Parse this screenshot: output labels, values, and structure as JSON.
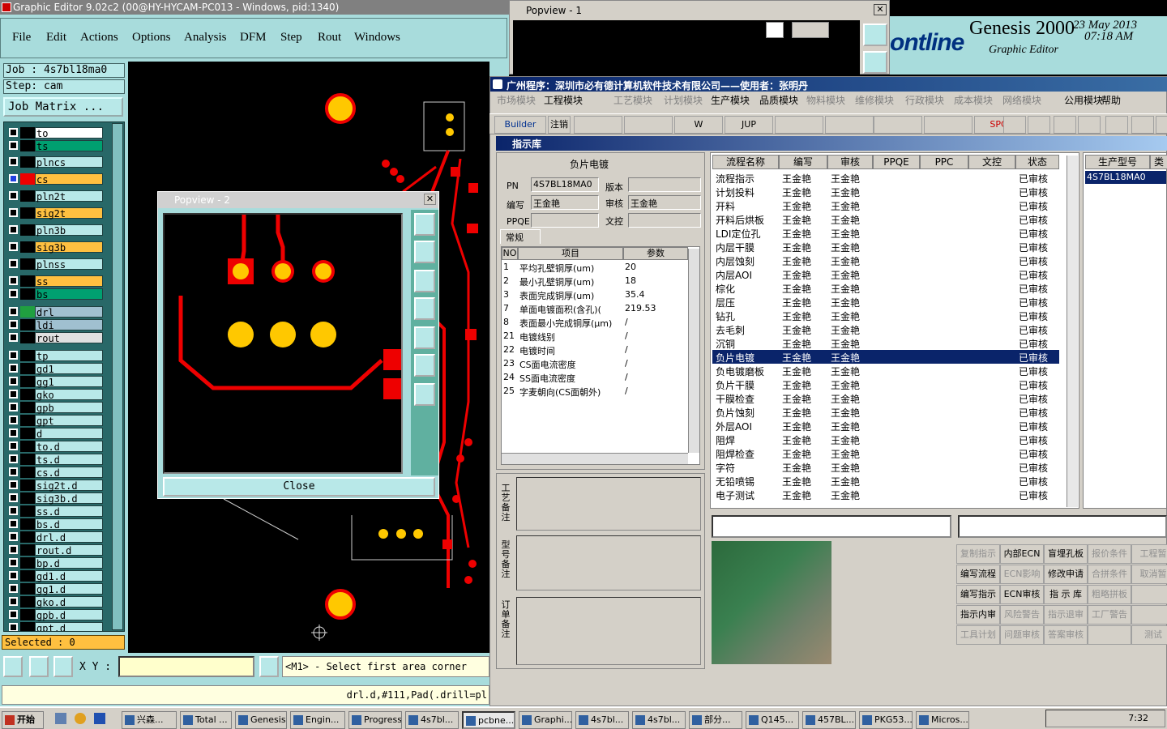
{
  "genesis": {
    "title": "Graphic Editor 9.02c2 (00@HY-HYCAM-PC013 - Windows, pid:1340)",
    "menu": [
      "File",
      "Edit",
      "Actions",
      "Options",
      "Analysis",
      "DFM",
      "Step",
      "Rout",
      "Windows"
    ],
    "job": "Job : 4s7bl18ma0",
    "step": "Step: cam",
    "job_matrix": "Job Matrix ...",
    "layers": [
      {
        "name": "to",
        "color": "#ffffff"
      },
      {
        "name": "ts",
        "color": "#00a070"
      },
      {
        "name": "plncs",
        "color": "#b8e8e8"
      },
      {
        "name": "cs",
        "color": "#ffc040"
      },
      {
        "name": "pln2t",
        "color": "#b8e8e8"
      },
      {
        "name": "sig2t",
        "color": "#ffc040"
      },
      {
        "name": "pln3b",
        "color": "#b8e8e8"
      },
      {
        "name": "sig3b",
        "color": "#ffc040"
      },
      {
        "name": "plnss",
        "color": "#b8e8e8"
      },
      {
        "name": "ss",
        "color": "#ffc040"
      },
      {
        "name": "bs",
        "color": "#00a070"
      },
      {
        "name": "drl",
        "color": "#a0c0d0"
      },
      {
        "name": "ldi",
        "color": "#a0c0d0"
      },
      {
        "name": "rout",
        "color": "#e0e0e0"
      },
      {
        "name": "tp",
        "color": "#b8e8e8"
      },
      {
        "name": "gd1",
        "color": "#b8e8e8"
      },
      {
        "name": "gg1",
        "color": "#b8e8e8"
      },
      {
        "name": "gko",
        "color": "#b8e8e8"
      },
      {
        "name": "gpb",
        "color": "#b8e8e8"
      },
      {
        "name": "gpt",
        "color": "#b8e8e8"
      },
      {
        "name": "d",
        "color": "#b8e8e8"
      },
      {
        "name": "to.d",
        "color": "#b8e8e8"
      },
      {
        "name": "ts.d",
        "color": "#b8e8e8"
      },
      {
        "name": "cs.d",
        "color": "#b8e8e8"
      },
      {
        "name": "sig2t.d",
        "color": "#b8e8e8"
      },
      {
        "name": "sig3b.d",
        "color": "#b8e8e8"
      },
      {
        "name": "ss.d",
        "color": "#b8e8e8"
      },
      {
        "name": "bs.d",
        "color": "#b8e8e8"
      },
      {
        "name": "drl.d",
        "color": "#b8e8e8"
      },
      {
        "name": "rout.d",
        "color": "#b8e8e8"
      },
      {
        "name": "bp.d",
        "color": "#b8e8e8"
      },
      {
        "name": "gd1.d",
        "color": "#b8e8e8"
      },
      {
        "name": "gg1.d",
        "color": "#b8e8e8"
      },
      {
        "name": "gko.d",
        "color": "#b8e8e8"
      },
      {
        "name": "gpb.d",
        "color": "#b8e8e8"
      },
      {
        "name": "gpt.d",
        "color": "#b8e8e8"
      }
    ],
    "selected": "Selected : 0",
    "xy_label": "X Y :",
    "xy_value": "",
    "message": "<M1> - Select first area corner",
    "status": "drl.d,#111,Pad(.drill=pl"
  },
  "popview2": {
    "title": "Popview - 2",
    "close": "Close"
  },
  "popview1": {
    "title": "Popview - 1"
  },
  "header": {
    "logo": "ontline",
    "product": "Genesis 2000",
    "date": "23 May 2013",
    "time": "07:18 AM",
    "subtitle": "Graphic Editor"
  },
  "app": {
    "title": "广州程序：深圳市必有德计算机软件技术有限公司——使用者：张明丹",
    "menu": [
      {
        "t": "市场模块",
        "d": true
      },
      {
        "t": "工程模块",
        "d": false
      },
      {
        "t": "工艺模块",
        "d": true
      },
      {
        "t": "计划模块",
        "d": true
      },
      {
        "t": "生产模块",
        "d": false
      },
      {
        "t": "品质模块",
        "d": false
      },
      {
        "t": "物料模块",
        "d": true
      },
      {
        "t": "维修模块",
        "d": true
      },
      {
        "t": "行政模块",
        "d": true
      },
      {
        "t": "成本模块",
        "d": true
      },
      {
        "t": "网络模块",
        "d": true
      },
      {
        "t": "公用模块",
        "d": false
      },
      {
        "t": "帮助",
        "d": false
      }
    ],
    "toolbar": [
      "Builder",
      "注销",
      "",
      "",
      "W",
      "JUP",
      "",
      "",
      "",
      "",
      "SPC"
    ],
    "subtitle": "指示库",
    "form": {
      "heading": "负片电镀",
      "pn_label": "PN",
      "pn": "4S7BL18MA0",
      "ver_label": "版本",
      "ver": "",
      "author_label": "编写",
      "author": "王金艳",
      "review_label": "审核",
      "review": "王金艳",
      "ppqe_label": "PPQE",
      "ppqe": "",
      "doc_label": "文控",
      "doc": "",
      "tab": "常规"
    },
    "params": {
      "headers": [
        "NO",
        "项目",
        "参数"
      ],
      "rows": [
        [
          "1",
          "平均孔壁铜厚(um)",
          "20"
        ],
        [
          "2",
          "最小孔壁铜厚(um)",
          "18"
        ],
        [
          "3",
          "表面完成铜厚(um)",
          "35.4"
        ],
        [
          "7",
          "单面电镀面积(含孔)(",
          "219.53"
        ],
        [
          "8",
          "表面最小完成铜厚(μm)",
          "/"
        ],
        [
          "21",
          "电镀线别",
          "/"
        ],
        [
          "22",
          "电镀时间",
          "/"
        ],
        [
          "23",
          "CS面电流密度",
          "/"
        ],
        [
          "24",
          "SS面电流密度",
          "/"
        ],
        [
          "25",
          "字麦朝向(CS面朝外)",
          "/"
        ]
      ]
    },
    "notes": [
      "工艺备注",
      "型号备注",
      "订单备注"
    ],
    "process": {
      "headers": [
        "流程名称",
        "编写",
        "审核",
        "PPQE",
        "PPC",
        "文控",
        "状态"
      ],
      "rows": [
        [
          "流程指示",
          "王金艳",
          "王金艳",
          "",
          "",
          "",
          "已审核"
        ],
        [
          "计划投料",
          "王金艳",
          "王金艳",
          "",
          "",
          "",
          "已审核"
        ],
        [
          "开料",
          "王金艳",
          "王金艳",
          "",
          "",
          "",
          "已审核"
        ],
        [
          "开料后烘板",
          "王金艳",
          "王金艳",
          "",
          "",
          "",
          "已审核"
        ],
        [
          "LDI定位孔",
          "王金艳",
          "王金艳",
          "",
          "",
          "",
          "已审核"
        ],
        [
          "内层干膜",
          "王金艳",
          "王金艳",
          "",
          "",
          "",
          "已审核"
        ],
        [
          "内层蚀刻",
          "王金艳",
          "王金艳",
          "",
          "",
          "",
          "已审核"
        ],
        [
          "内层AOI",
          "王金艳",
          "王金艳",
          "",
          "",
          "",
          "已审核"
        ],
        [
          "棕化",
          "王金艳",
          "王金艳",
          "",
          "",
          "",
          "已审核"
        ],
        [
          "层压",
          "王金艳",
          "王金艳",
          "",
          "",
          "",
          "已审核"
        ],
        [
          "钻孔",
          "王金艳",
          "王金艳",
          "",
          "",
          "",
          "已审核"
        ],
        [
          "去毛刺",
          "王金艳",
          "王金艳",
          "",
          "",
          "",
          "已审核"
        ],
        [
          "沉铜",
          "王金艳",
          "王金艳",
          "",
          "",
          "",
          "已审核"
        ],
        [
          "负片电镀",
          "王金艳",
          "王金艳",
          "",
          "",
          "",
          "已审核"
        ],
        [
          "负电镀磨板",
          "王金艳",
          "王金艳",
          "",
          "",
          "",
          "已审核"
        ],
        [
          "负片干膜",
          "王金艳",
          "王金艳",
          "",
          "",
          "",
          "已审核"
        ],
        [
          "干膜检查",
          "王金艳",
          "王金艳",
          "",
          "",
          "",
          "已审核"
        ],
        [
          "负片蚀刻",
          "王金艳",
          "王金艳",
          "",
          "",
          "",
          "已审核"
        ],
        [
          "外层AOI",
          "王金艳",
          "王金艳",
          "",
          "",
          "",
          "已审核"
        ],
        [
          "阻焊",
          "王金艳",
          "王金艳",
          "",
          "",
          "",
          "已审核"
        ],
        [
          "阻焊检查",
          "王金艳",
          "王金艳",
          "",
          "",
          "",
          "已审核"
        ],
        [
          "字符",
          "王金艳",
          "王金艳",
          "",
          "",
          "",
          "已审核"
        ],
        [
          "无铅喷锡",
          "王金艳",
          "王金艳",
          "",
          "",
          "",
          "已审核"
        ],
        [
          "电子测试",
          "王金艳",
          "王金艳",
          "",
          "",
          "",
          "已审核"
        ]
      ]
    },
    "product": {
      "header": "生产型号",
      "header2": "类",
      "value": "4S7BL18MA0"
    },
    "buttons": [
      [
        {
          "t": "复制指示",
          "d": true
        },
        {
          "t": "内部ECN",
          "d": false
        },
        {
          "t": "盲埋孔板",
          "d": false
        },
        {
          "t": "报价条件",
          "d": true
        },
        {
          "t": "工程暂",
          "d": true
        }
      ],
      [
        {
          "t": "编写流程",
          "d": false
        },
        {
          "t": "ECN影响",
          "d": true
        },
        {
          "t": "修改申请",
          "d": false
        },
        {
          "t": "合拼条件",
          "d": true
        },
        {
          "t": "取消暂",
          "d": true
        }
      ],
      [
        {
          "t": "编写指示",
          "d": false
        },
        {
          "t": "ECN审核",
          "d": false
        },
        {
          "t": "指 示 库",
          "d": false
        },
        {
          "t": "粗略拼板",
          "d": true
        },
        {
          "t": "",
          "d": true
        }
      ],
      [
        {
          "t": "指示内审",
          "d": false
        },
        {
          "t": "风险警告",
          "d": true
        },
        {
          "t": "指示退审",
          "d": true
        },
        {
          "t": "工厂警告",
          "d": true
        },
        {
          "t": "",
          "d": true
        }
      ],
      [
        {
          "t": "工具计划",
          "d": true
        },
        {
          "t": "问题审核",
          "d": true
        },
        {
          "t": "答案审核",
          "d": true
        },
        {
          "t": "",
          "d": true
        },
        {
          "t": "测试",
          "d": true
        }
      ]
    ]
  },
  "taskbar": {
    "start": "开始",
    "items": [
      "兴森...",
      "Total ...",
      "Genesis",
      "Engin...",
      "Progress",
      "4s7bl...",
      "pcbne...",
      "Graphi...",
      "4s7bl...",
      "4s7bl...",
      "部分...",
      "Q145...",
      "457BL...",
      "PKG53...",
      "Micros..."
    ],
    "active": 6,
    "clock": "7:32"
  }
}
